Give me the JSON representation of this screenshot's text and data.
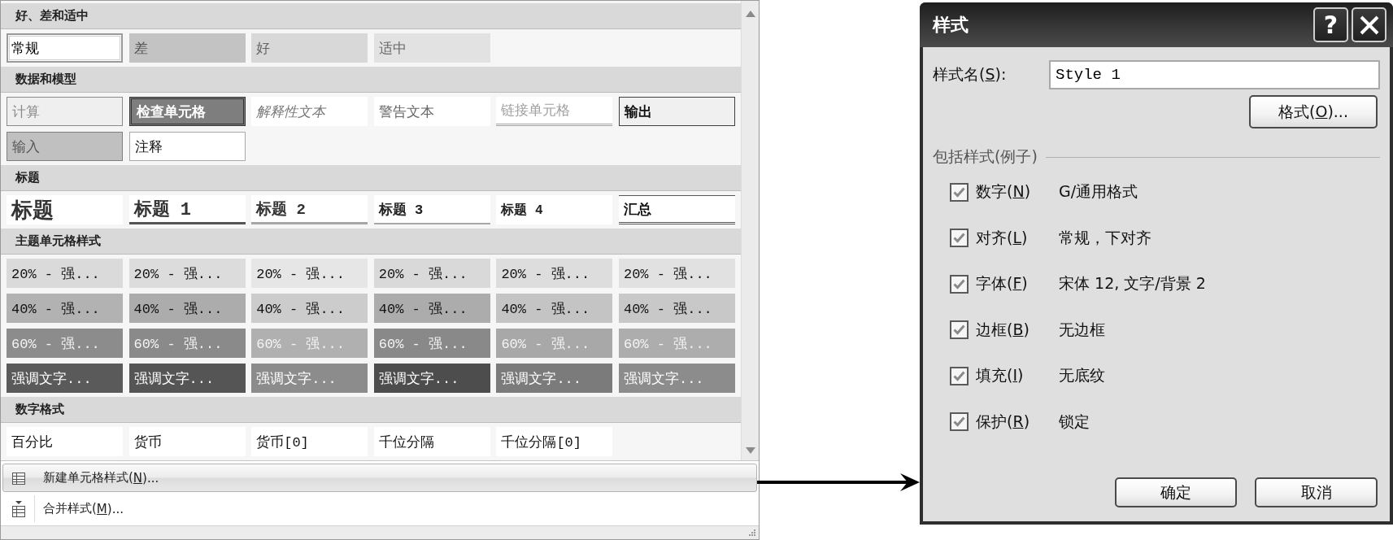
{
  "gallery": {
    "sections": [
      {
        "title": "好、差和适中",
        "rows": [
          [
            {
              "label": "常规",
              "kind": "normal",
              "selected": true
            },
            {
              "label": "差",
              "kind": "bad",
              "selected": false
            },
            {
              "label": "好",
              "kind": "good",
              "selected": false
            },
            {
              "label": "适中",
              "kind": "neutral",
              "selected": false
            }
          ]
        ]
      },
      {
        "title": "数据和模型",
        "rows": [
          [
            {
              "label": "计算",
              "kind": "calculation",
              "selected": false
            },
            {
              "label": "检查单元格",
              "kind": "check",
              "selected": false
            },
            {
              "label": "解释性文本",
              "kind": "explanatory",
              "selected": false
            },
            {
              "label": "警告文本",
              "kind": "warning",
              "selected": false
            },
            {
              "label": "链接单元格",
              "kind": "linked",
              "selected": false
            },
            {
              "label": "输出",
              "kind": "output",
              "selected": false
            }
          ],
          [
            {
              "label": "输入",
              "kind": "input",
              "selected": false
            },
            {
              "label": "注释",
              "kind": "note",
              "selected": false
            }
          ]
        ]
      },
      {
        "title": "标题",
        "rows": [
          [
            {
              "label": "标题",
              "kind": "title",
              "selected": false
            },
            {
              "label": "标题 1",
              "kind": "heading1",
              "selected": false
            },
            {
              "label": "标题 2",
              "kind": "heading2",
              "selected": false
            },
            {
              "label": "标题 3",
              "kind": "heading3",
              "selected": false
            },
            {
              "label": "标题 4",
              "kind": "heading4",
              "selected": false
            },
            {
              "label": "汇总",
              "kind": "total",
              "selected": false
            }
          ]
        ]
      },
      {
        "title": "主题单元格样式",
        "rows": [
          [
            {
              "label": "20% - 强...",
              "kind": "tint20",
              "color": "#dadada",
              "selected": false
            },
            {
              "label": "20% - 强...",
              "kind": "tint20",
              "color": "#dcdcdc",
              "selected": false
            },
            {
              "label": "20% - 强...",
              "kind": "tint20",
              "color": "#e6e6e6",
              "selected": false
            },
            {
              "label": "20% - 强...",
              "kind": "tint20",
              "color": "#d9d9d9",
              "selected": false
            },
            {
              "label": "20% - 强...",
              "kind": "tint20",
              "color": "#dddddd",
              "selected": false
            },
            {
              "label": "20% - 强...",
              "kind": "tint20",
              "color": "#e1e1e1",
              "selected": false
            }
          ],
          [
            {
              "label": "40% - 强...",
              "kind": "tint40",
              "color": "#b2b2b2",
              "selected": false
            },
            {
              "label": "40% - 强...",
              "kind": "tint40",
              "color": "#acacac",
              "selected": false
            },
            {
              "label": "40% - 强...",
              "kind": "tint40",
              "color": "#cccccc",
              "selected": false
            },
            {
              "label": "40% - 强...",
              "kind": "tint40",
              "color": "#acacac",
              "selected": false
            },
            {
              "label": "40% - 强...",
              "kind": "tint40",
              "color": "#c4c4c4",
              "selected": false
            },
            {
              "label": "40% - 强...",
              "kind": "tint40",
              "color": "#c8c8c8",
              "selected": false
            }
          ],
          [
            {
              "label": "60% - 强...",
              "kind": "tint60",
              "color": "#8c8c8c",
              "selected": false
            },
            {
              "label": "60% - 强...",
              "kind": "tint60",
              "color": "#8a8a8a",
              "selected": false
            },
            {
              "label": "60% - 强...",
              "kind": "tint60",
              "color": "#b0b0b0",
              "selected": false
            },
            {
              "label": "60% - 强...",
              "kind": "tint60",
              "color": "#898989",
              "selected": false
            },
            {
              "label": "60% - 强...",
              "kind": "tint60",
              "color": "#a8a8a8",
              "selected": false
            },
            {
              "label": "60% - 强...",
              "kind": "tint60",
              "color": "#adadad",
              "selected": false
            }
          ],
          [
            {
              "label": "强调文字...",
              "kind": "accent",
              "color": "#5a5a5a",
              "selected": false
            },
            {
              "label": "强调文字...",
              "kind": "accent",
              "color": "#555555",
              "selected": false
            },
            {
              "label": "强调文字...",
              "kind": "accent",
              "color": "#8c8c8c",
              "selected": false
            },
            {
              "label": "强调文字...",
              "kind": "accent",
              "color": "#4d4d4d",
              "selected": false
            },
            {
              "label": "强调文字...",
              "kind": "accent",
              "color": "#7b7b7b",
              "selected": false
            },
            {
              "label": "强调文字...",
              "kind": "accent",
              "color": "#8c8c8c",
              "selected": false
            }
          ]
        ]
      },
      {
        "title": "数字格式",
        "rows": [
          [
            {
              "label": "百分比",
              "kind": "number",
              "selected": false
            },
            {
              "label": "货币",
              "kind": "number",
              "selected": false
            },
            {
              "label": "货币[0]",
              "kind": "number",
              "selected": false
            },
            {
              "label": "千位分隔",
              "kind": "number",
              "selected": false
            },
            {
              "label": "千位分隔[0]",
              "kind": "number",
              "selected": false
            }
          ]
        ]
      }
    ]
  },
  "menu": [
    {
      "label": {
        "pre": "新建单元格样式(",
        "key": "N",
        "post": ")..."
      },
      "highlighted": true
    },
    {
      "label": {
        "pre": "合并样式(",
        "key": "M",
        "post": ")..."
      },
      "highlighted": false
    }
  ],
  "dialog": {
    "title": "样式",
    "help_button": "?",
    "name_field": {
      "label": {
        "pre": "样式名(",
        "key": "S",
        "post": "):"
      },
      "value": "Style 1"
    },
    "format_button": {
      "pre": "格式(",
      "key": "O",
      "post": ")..."
    },
    "group_label": "包括样式(例子)",
    "includes": [
      {
        "label": {
          "pre": "数字(",
          "key": "N",
          "post": ")"
        },
        "value": "G/通用格式",
        "checked": true
      },
      {
        "label": {
          "pre": "对齐(",
          "key": "L",
          "post": ")"
        },
        "value": "常规，下对齐",
        "checked": true
      },
      {
        "label": {
          "pre": "字体(",
          "key": "F",
          "post": ")"
        },
        "value": "宋体 12, 文字/背景 2",
        "checked": true
      },
      {
        "label": {
          "pre": "边框(",
          "key": "B",
          "post": ")"
        },
        "value": "无边框",
        "checked": true
      },
      {
        "label": {
          "pre": "填充(",
          "key": "I",
          "post": ")"
        },
        "value": "无底纹",
        "checked": true
      },
      {
        "label": {
          "pre": "保护(",
          "key": "R",
          "post": ")"
        },
        "value": "锁定",
        "checked": true
      }
    ],
    "buttons": [
      "确定",
      "取消"
    ]
  }
}
